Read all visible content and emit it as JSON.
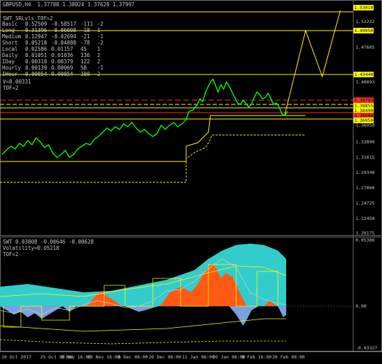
{
  "header": {
    "symbol_line": "GBPUSD,H4  1.37708 1.38024 1.37628 1.37997"
  },
  "srlevels_panel": {
    "title": "SWT_SRLvls_TOF=2",
    "rows": [
      [
        "Basic",
        "0.52509",
        "-0.58517",
        "-111",
        "-2"
      ],
      [
        "Long",
        "0.31396",
        "-0.06008",
        "-18",
        "1"
      ],
      [
        "Medium",
        "0.12947",
        "-0.02694",
        "-21",
        "-1"
      ],
      [
        "Short",
        "0.05218",
        "-0.04080",
        "-78",
        "-2"
      ],
      [
        "Local",
        "0.02586",
        "0.01157",
        "45",
        "1"
      ],
      [
        "Daily",
        "0.01051",
        "0.01036",
        "136",
        "2"
      ],
      [
        "IDay",
        "0.00310",
        "0.00379",
        "122",
        "2"
      ],
      [
        "Hourly",
        "0.00139",
        "0.00069",
        "50",
        "-1"
      ],
      [
        "IHour",
        "0.00054",
        "0.00054",
        "100",
        "2"
      ]
    ],
    "v_line": "V=0.00331",
    "tof_line": "TOF=2"
  },
  "price_axis": {
    "labels": [
      "1.52222",
      "1.47605",
      "1.40093",
      "1.36950",
      "1.33890",
      "1.31615",
      "1.29340",
      "1.27000",
      "1.24725",
      "1.22450",
      "1.20175"
    ],
    "tags": [
      {
        "text": "1.53010",
        "color": "#ffff00"
      },
      {
        "text": "1.49950",
        "color": "#ffff00"
      },
      {
        "text": "1.43440",
        "color": "#ffff00"
      },
      {
        "text": "1.39793",
        "color": "#ff3030"
      },
      {
        "text": "1.38855",
        "color": "#ffff00"
      },
      {
        "text": "1.38490",
        "color": "#ffff00"
      },
      {
        "text": "1.38080",
        "color": "#ff3030"
      },
      {
        "text": "1.36950",
        "color": "#ffff00"
      }
    ]
  },
  "oscillator": {
    "header": "SWT 0.03808 -0.00646 -0.00628",
    "volatility": "Volatility=0.05218",
    "tof": "TOF=2",
    "axis_labels": [
      "0.05386",
      "0.00",
      "-0.03327"
    ]
  },
  "time_axis": {
    "labels": [
      "10 Oct 2017",
      "25 Oct 08:00",
      "9 Nov 16:00",
      "23 Nov 16:00",
      "8 Dec 08:00",
      "26 Dec 08:00",
      "11 Jan 08:00",
      "26 Jan 08:00",
      "9 Feb 16:00",
      "26 Feb 08:00"
    ]
  },
  "colors": {
    "candles": "#00ff00",
    "support": "#ffff00",
    "resistance": "#ff3030",
    "osc_cyan": "#33cccc",
    "osc_orange": "#ff5a14",
    "osc_blue": "#7aa0e0"
  }
}
